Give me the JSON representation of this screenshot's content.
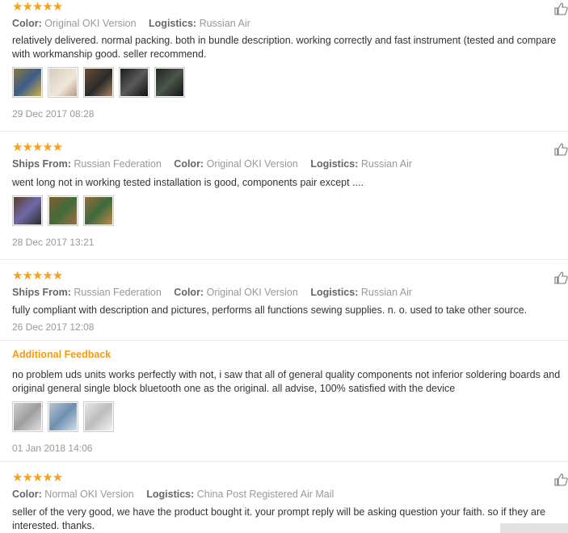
{
  "reviews": [
    {
      "stars": "★★★★★",
      "meta": [
        {
          "label": "Color:",
          "value": "Original OKI Version"
        },
        {
          "label": "Logistics:",
          "value": "Russian Air"
        }
      ],
      "text": "relatively delivered. normal packing. both in bundle description. working correctly and fast instrument (tested and compare with workmanship good. seller recommend.",
      "date": "29 Dec 2017 08:28"
    },
    {
      "stars": "★★★★★",
      "meta": [
        {
          "label": "Ships From:",
          "value": "Russian Federation"
        },
        {
          "label": "Color:",
          "value": "Original OKI Version"
        },
        {
          "label": "Logistics:",
          "value": "Russian Air"
        }
      ],
      "text": "went long not in working tested installation is good, components pair except ....",
      "date": "28 Dec 2017 13:21"
    },
    {
      "stars": "★★★★★",
      "meta": [
        {
          "label": "Ships From:",
          "value": "Russian Federation"
        },
        {
          "label": "Color:",
          "value": "Original OKI Version"
        },
        {
          "label": "Logistics:",
          "value": "Russian Air"
        }
      ],
      "text": "fully compliant with description and pictures, performs all functions sewing supplies. n. o. used to take other source.",
      "date": "26 Dec 2017 12:08",
      "additional": {
        "heading": "Additional Feedback",
        "text": "no problem uds units works perfectly with not, i saw that all of general quality components not inferior soldering boards and original general single block bluetooth one as the original. all advise, 100% satisfied with the device",
        "date": "01 Jan 2018 14:06"
      }
    },
    {
      "stars": "★★★★★",
      "meta": [
        {
          "label": "Color:",
          "value": "Normal OKI Version"
        },
        {
          "label": "Logistics:",
          "value": "China Post Registered Air Mail"
        }
      ],
      "text": "seller of the very good, we have the product bought it. your prompt reply will be asking question your faith. so if they are interested. thanks."
    }
  ],
  "colors": {
    "star": "#f7a21b",
    "additional_heading": "#f39c12",
    "label": "#666666",
    "muted": "#999999"
  },
  "icons": {
    "like": "thumbs-up-icon"
  }
}
